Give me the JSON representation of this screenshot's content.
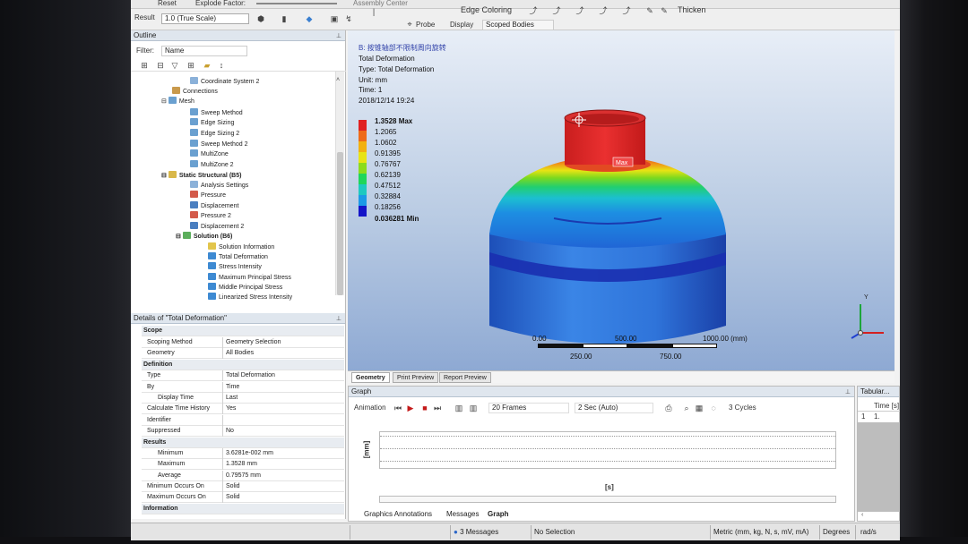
{
  "toolbar_top": {
    "reset_label": "Reset",
    "explode_label": "Explode Factor:",
    "assembly_center": "Assembly Center",
    "edge_coloring": "Edge Coloring",
    "thicken": "Thicken"
  },
  "toolbar_main": {
    "result_label": "Result",
    "result_scale": "1.0 (True Scale)",
    "probe": "Probe",
    "display": "Display",
    "scoped_bodies": "Scoped Bodies"
  },
  "outline": {
    "title": "Outline",
    "filter_label": "Filter:",
    "filter_value": "Name",
    "items": [
      {
        "label": "Coordinate System 2",
        "color": "#8bb1d9"
      },
      {
        "label": "Connections",
        "color": "#c99a4c"
      },
      {
        "label": "Mesh",
        "color": "#6aa0d0"
      },
      {
        "label": "Sweep Method",
        "color": "#6aa0d0"
      },
      {
        "label": "Edge Sizing",
        "color": "#6aa0d0"
      },
      {
        "label": "Edge Sizing 2",
        "color": "#6aa0d0"
      },
      {
        "label": "Sweep Method 2",
        "color": "#6aa0d0"
      },
      {
        "label": "MultiZone",
        "color": "#6aa0d0"
      },
      {
        "label": "MultiZone 2",
        "color": "#6aa0d0"
      },
      {
        "label": "Static Structural (B5)",
        "color": "#d9b84a"
      },
      {
        "label": "Analysis Settings",
        "color": "#8bb1d9"
      },
      {
        "label": "Pressure",
        "color": "#d35a4a"
      },
      {
        "label": "Displacement",
        "color": "#4a7fc0"
      },
      {
        "label": "Pressure 2",
        "color": "#d35a4a"
      },
      {
        "label": "Displacement 2",
        "color": "#4a7fc0"
      },
      {
        "label": "Solution (B6)",
        "color": "#5cae5c"
      },
      {
        "label": "Solution Information",
        "color": "#e2c54c"
      },
      {
        "label": "Total Deformation",
        "color": "#3e8ad2"
      },
      {
        "label": "Stress Intensity",
        "color": "#3e8ad2"
      },
      {
        "label": "Maximum Principal Stress",
        "color": "#3e8ad2"
      },
      {
        "label": "Middle Principal Stress",
        "color": "#3e8ad2"
      },
      {
        "label": "Linearized Stress Intensity",
        "color": "#3e8ad2"
      }
    ]
  },
  "details": {
    "title": "Details of \"Total Deformation\"",
    "rows": [
      {
        "k": "Scope",
        "v": "",
        "sec": true
      },
      {
        "k": "Scoping Method",
        "v": "Geometry Selection"
      },
      {
        "k": "Geometry",
        "v": "All Bodies"
      },
      {
        "k": "Definition",
        "v": "",
        "sec": true
      },
      {
        "k": "Type",
        "v": "Total Deformation"
      },
      {
        "k": "By",
        "v": "Time"
      },
      {
        "k": "Display Time",
        "v": "Last"
      },
      {
        "k": "Calculate Time History",
        "v": "Yes"
      },
      {
        "k": "Identifier",
        "v": ""
      },
      {
        "k": "Suppressed",
        "v": "No"
      },
      {
        "k": "Results",
        "v": "",
        "sec": true
      },
      {
        "k": "Minimum",
        "v": "3.6281e-002 mm"
      },
      {
        "k": "Maximum",
        "v": "1.3528 mm"
      },
      {
        "k": "Average",
        "v": "0.79575 mm"
      },
      {
        "k": "Minimum Occurs On",
        "v": "Solid"
      },
      {
        "k": "Maximum Occurs On",
        "v": "Solid"
      },
      {
        "k": "Information",
        "v": "",
        "sec": true
      }
    ]
  },
  "viewport": {
    "heading": "B: 按锥轴部不限制周向旋转",
    "result_name": "Total Deformation",
    "type_line": "Type: Total Deformation",
    "unit_line": "Unit: mm",
    "time_line": "Time: 1",
    "date_line": "2018/12/14 19:24",
    "max_tag": "Max",
    "legend": [
      {
        "label": "1.3528 Max",
        "color": "#e02020"
      },
      {
        "label": "1.2065",
        "color": "#ee6a18"
      },
      {
        "label": "1.0602",
        "color": "#f2b10f"
      },
      {
        "label": "0.91395",
        "color": "#e8e414"
      },
      {
        "label": "0.76767",
        "color": "#8cdc1c"
      },
      {
        "label": "0.62139",
        "color": "#1fd65a"
      },
      {
        "label": "0.47512",
        "color": "#1ec9c0"
      },
      {
        "label": "0.32884",
        "color": "#1c9ae6"
      },
      {
        "label": "0.18256",
        "color": "#1a55e0"
      },
      {
        "label": "0.036281 Min",
        "color": "#1414c8"
      }
    ],
    "scale_labels": {
      "zero": "0.00",
      "mid": "500.00",
      "end": "1000.00 (mm)",
      "q1": "250.00",
      "q3": "750.00"
    },
    "tabs": [
      "Geometry",
      "Print Preview",
      "Report Preview"
    ]
  },
  "graph": {
    "title": "Graph",
    "animation_label": "Animation",
    "frames": "20 Frames",
    "duration": "2 Sec (Auto)",
    "cycles": "3 Cycles",
    "y_unit": "[mm]",
    "x_unit": "[s]"
  },
  "tabular": {
    "title": "Tabular...",
    "col": "Time [s]",
    "row_index": "1",
    "row_val": "1."
  },
  "bottom_tabs": [
    "Graphics Annotations",
    "Messages",
    "Graph"
  ],
  "status": {
    "messages": "3 Messages",
    "selection": "No Selection",
    "units": "Metric (mm, kg, N, s, mV, mA)",
    "degrees": "Degrees",
    "rads": "rad/s"
  }
}
